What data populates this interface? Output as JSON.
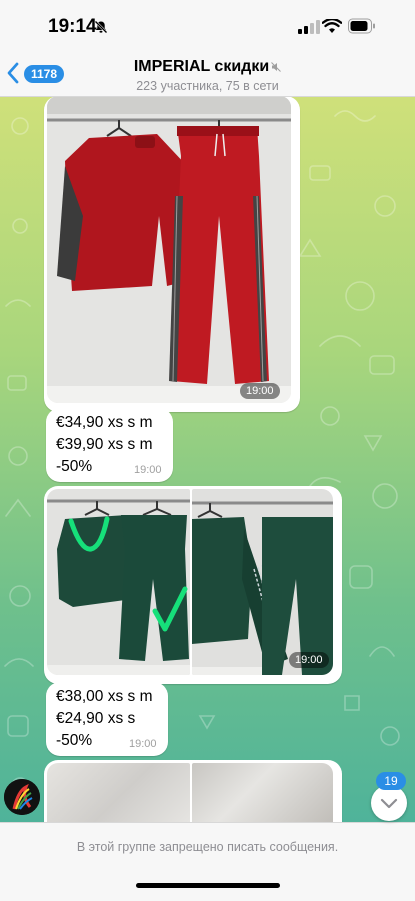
{
  "status_bar": {
    "time": "19:14"
  },
  "header": {
    "back_count": "1178",
    "title": "IMPERIAL скидки",
    "subtitle": "223 участника, 75 в сети"
  },
  "messages": [
    {
      "type": "photo",
      "time": "19:00"
    },
    {
      "type": "text",
      "lines": [
        "€34,90 xs s m",
        "€39,90 xs s m",
        "-50%"
      ],
      "time": "19:00"
    },
    {
      "type": "photo_album",
      "time": "19:00"
    },
    {
      "type": "text",
      "lines": [
        "€38,00 xs s m",
        "€24,90 xs s",
        "-50%"
      ],
      "time": "19:00"
    }
  ],
  "unread_count": "19",
  "composer": {
    "notice": "В этой группе запрещено писать сообщения."
  },
  "colors": {
    "accent": "#2a8ee5",
    "red_garment": "#b0161e",
    "green_garment": "#1b4a3a"
  }
}
